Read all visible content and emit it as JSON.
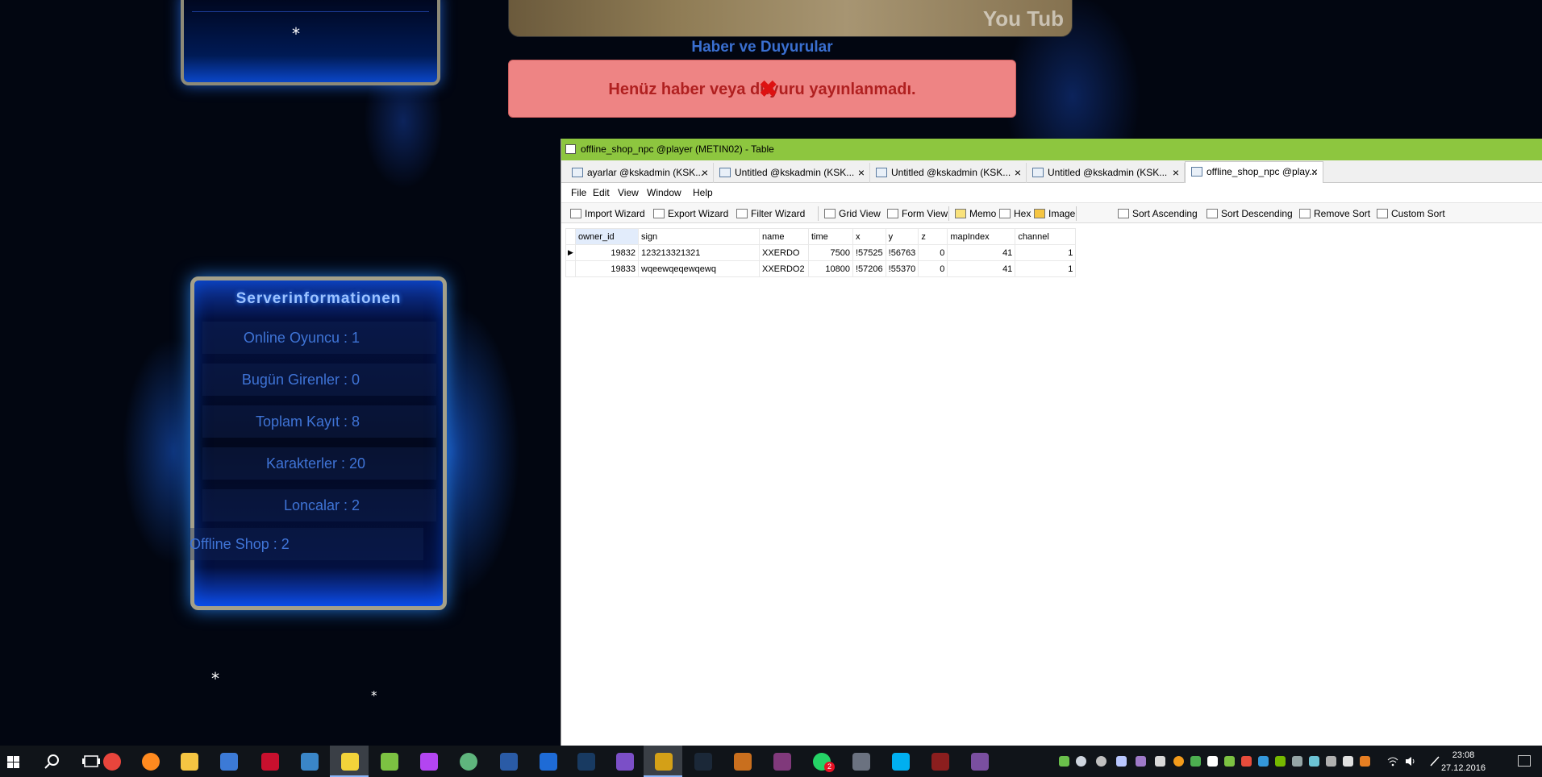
{
  "background_page": {
    "news_title": "Haber ve Duyurular",
    "news_message": "Henüz haber veya duyuru yayınlanmadı.",
    "video_watermark": "You Tub",
    "stars": [
      "*",
      "*",
      "*"
    ],
    "server_info": {
      "title": "Serverinformationen",
      "rows": [
        {
          "label": "Online Oyuncu : 1"
        },
        {
          "label": "Bugün Girenler : 0"
        },
        {
          "label": "Toplam Kayıt : 8"
        },
        {
          "label": "Karakterler : 20"
        },
        {
          "label": "Loncalar : 2"
        },
        {
          "label": "Offline Shop : 2"
        }
      ]
    }
  },
  "window": {
    "title": "offline_shop_npc @player (METIN02) - Table",
    "tabs": [
      {
        "label": "ayarlar @kskadmin (KSK...",
        "close": "×"
      },
      {
        "label": "Untitled @kskadmin (KSK...",
        "close": "×"
      },
      {
        "label": "Untitled @kskadmin (KSK...",
        "close": "×"
      },
      {
        "label": "Untitled @kskadmin (KSK...",
        "close": "×"
      },
      {
        "label": "offline_shop_npc @play...",
        "close": "×",
        "active": true
      }
    ],
    "menu": [
      "File",
      "Edit",
      "View",
      "Window",
      "Help"
    ],
    "toolbar": {
      "import_wizard": "Import Wizard",
      "export_wizard": "Export Wizard",
      "filter_wizard": "Filter Wizard",
      "grid_view": "Grid View",
      "form_view": "Form View",
      "memo": "Memo",
      "hex": "Hex",
      "image": "Image",
      "sort_ascending": "Sort Ascending",
      "sort_descending": "Sort Descending",
      "remove_sort": "Remove Sort",
      "custom_sort": "Custom Sort"
    },
    "table": {
      "columns": [
        "owner_id",
        "sign",
        "name",
        "time",
        "x",
        "y",
        "z",
        "mapIndex",
        "channel"
      ],
      "rows": [
        {
          "indicator": "▶",
          "owner_id": "19832",
          "sign": "123213321321",
          "name": "XXERDO",
          "time": "7500",
          "x": "!57525",
          "y": "!56763",
          "z": "0",
          "mapIndex": "41",
          "channel": "1"
        },
        {
          "indicator": "",
          "owner_id": "19833",
          "sign": "wqeewqeqewqewq",
          "name": "XXERDO2",
          "time": "10800",
          "x": "!57206",
          "y": "!55370",
          "z": "0",
          "mapIndex": "41",
          "channel": "1"
        }
      ]
    }
  },
  "taskbar": {
    "clock_time": "23:08",
    "clock_date": "27.12.2016",
    "badge_count": "2",
    "apps": [
      {
        "icon": "chrome-icon",
        "color": "#e8453c"
      },
      {
        "icon": "firefox-icon",
        "color": "#ff8a1f"
      },
      {
        "icon": "file-explorer-icon",
        "color": "#f5c542"
      },
      {
        "icon": "network-tool-icon",
        "color": "#3c7ad6"
      },
      {
        "icon": "filezilla-icon",
        "color": "#c8102e"
      },
      {
        "icon": "archive-tool-icon",
        "color": "#3a86c8"
      },
      {
        "icon": "navicat-icon",
        "color": "#f2d33a"
      },
      {
        "icon": "notepad-plus-icon",
        "color": "#7cc242"
      },
      {
        "icon": "phpstorm-icon",
        "color": "#b345f1"
      },
      {
        "icon": "atom-icon",
        "color": "#5fb57d"
      },
      {
        "icon": "photoshop-icon",
        "color": "#2a5ba6"
      },
      {
        "icon": "folder-app-icon",
        "color": "#1e6bd6"
      },
      {
        "icon": "virtualbox-icon",
        "color": "#183a61"
      },
      {
        "icon": "visual-studio-icon",
        "color": "#7b4fc7"
      },
      {
        "icon": "game-client-icon",
        "color": "#d4a017"
      },
      {
        "icon": "steam-icon",
        "color": "#1b2838"
      },
      {
        "icon": "metin2-icon",
        "color": "#c96f1e"
      },
      {
        "icon": "onenote-icon",
        "color": "#80397b"
      },
      {
        "icon": "whatsapp-icon",
        "color": "#25d366"
      },
      {
        "icon": "tools-icon",
        "color": "#6b7280"
      },
      {
        "icon": "skype-icon",
        "color": "#00aff0"
      },
      {
        "icon": "game2-icon",
        "color": "#8b1e1e"
      },
      {
        "icon": "winrar-icon",
        "color": "#7a4fa0"
      }
    ]
  }
}
